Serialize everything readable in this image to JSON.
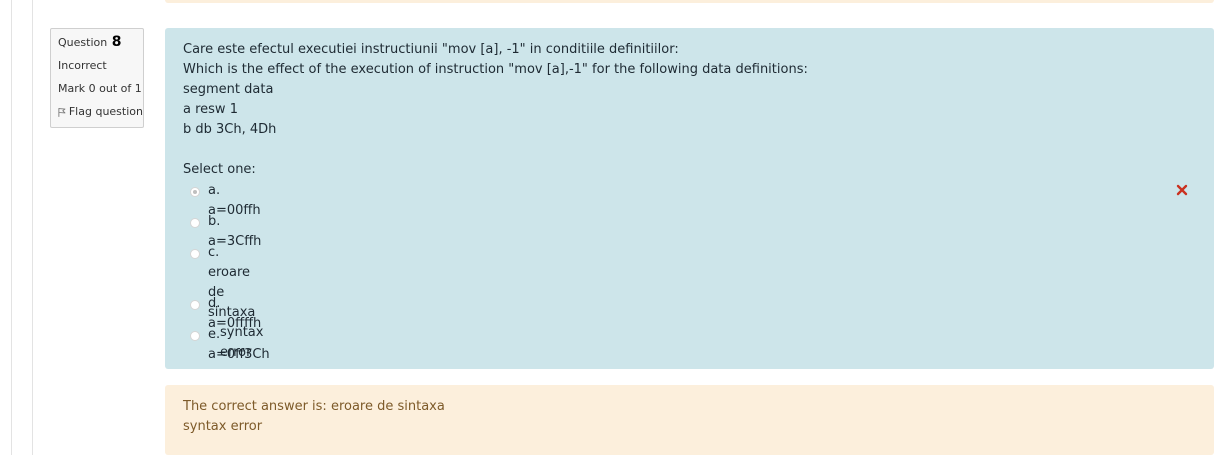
{
  "info": {
    "question_label": "Question",
    "question_number": "8",
    "state": "Incorrect",
    "grade": "Mark 0 out of 1",
    "flag_label": "Flag question"
  },
  "question": {
    "lines": [
      "Care este efectul executiei instructiunii \"mov [a], -1\" in conditiile definitiilor:",
      "Which is the effect of the execution of instruction \"mov [a],-1\" for the following data definitions:",
      "segment data",
      "a resw 1",
      "b db 3Ch, 4Dh"
    ],
    "prompt": "Select one:"
  },
  "options": [
    {
      "label": "a. a=00ffh",
      "selected": true,
      "incorrect_mark": true
    },
    {
      "label": "b. a=3Cffh",
      "selected": false
    },
    {
      "label": "c. eroare de sintaxa",
      "sub": "syntax error",
      "selected": false
    },
    {
      "label": "d. a=0ffffh",
      "selected": false
    },
    {
      "label": "e. a=0ff3Ch",
      "selected": false
    }
  ],
  "feedback": {
    "line1": "The correct answer is: eroare de sintaxa",
    "line2": "syntax error"
  },
  "colors": {
    "formulation_bg": "#cde5ea",
    "feedback_bg": "#fcefdc",
    "incorrect_icon": "#ca3120"
  },
  "icons": {
    "flag": "flag-outline-icon",
    "incorrect": "cross-icon"
  }
}
